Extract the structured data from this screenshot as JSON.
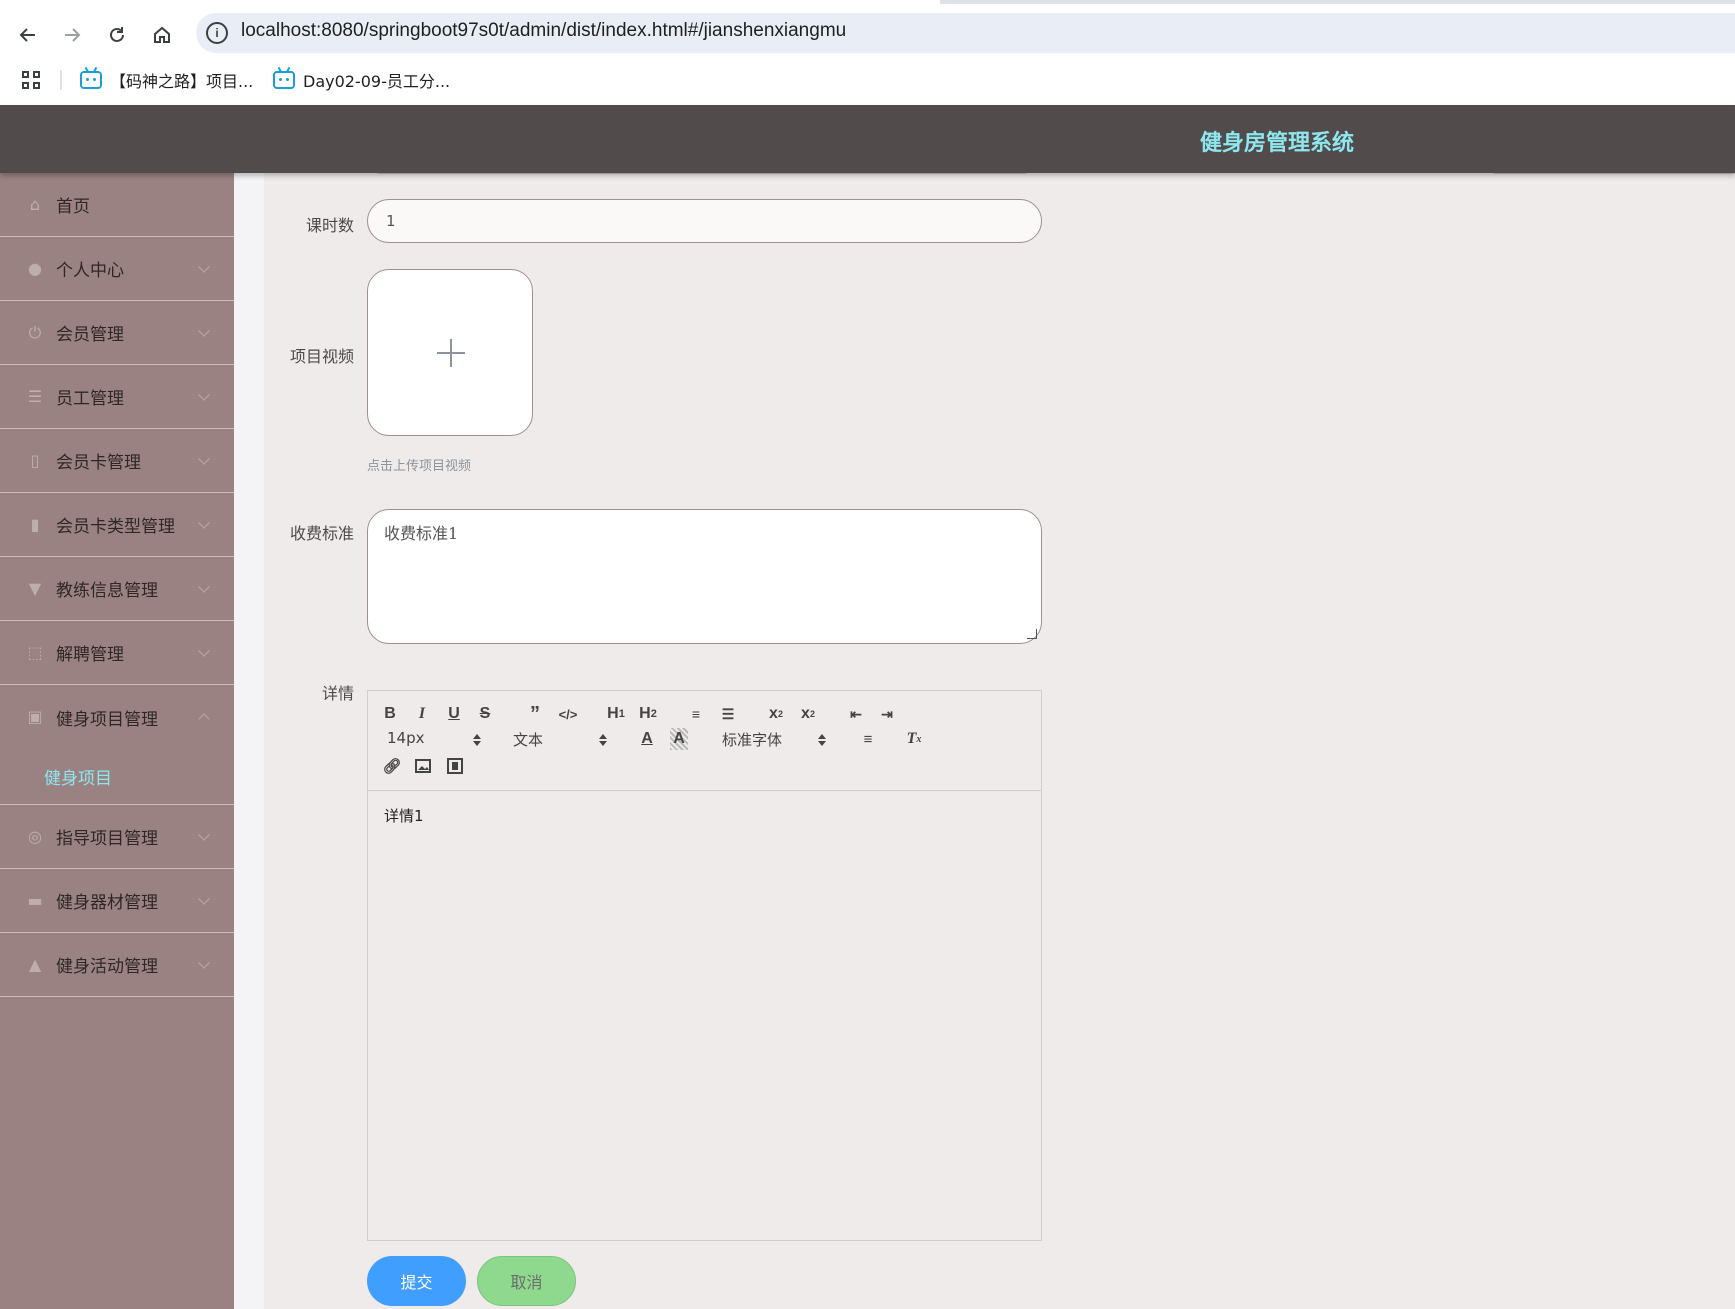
{
  "browser": {
    "url": "localhost:8080/springboot97s0t/admin/dist/index.html#/jianshenxiangmu",
    "bookmarks": [
      {
        "label": "【码神之路】项目..."
      },
      {
        "label": "Day02-09-员工分..."
      }
    ]
  },
  "header": {
    "title": "健身房管理系统"
  },
  "sidebar": {
    "items": [
      {
        "label": "首页",
        "icon": "home-icon"
      },
      {
        "label": "个人中心",
        "icon": "user-icon"
      },
      {
        "label": "会员管理",
        "icon": "power-icon"
      },
      {
        "label": "员工管理",
        "icon": "list-icon"
      },
      {
        "label": "会员卡管理",
        "icon": "phone-icon"
      },
      {
        "label": "会员卡类型管理",
        "icon": "chart-icon"
      },
      {
        "label": "教练信息管理",
        "icon": "pin-icon"
      },
      {
        "label": "解聘管理",
        "icon": "frame-icon"
      },
      {
        "label": "健身项目管理",
        "icon": "clipboard-icon"
      },
      {
        "label": "指导项目管理",
        "icon": "compass-icon"
      },
      {
        "label": "健身器材管理",
        "icon": "ticket-icon"
      },
      {
        "label": "健身活动管理",
        "icon": "thumb-icon"
      }
    ],
    "active_sub": {
      "label": "健身项目"
    }
  },
  "form": {
    "class_hours": {
      "label": "课时数",
      "value": "1"
    },
    "video": {
      "label": "项目视频",
      "tip": "点击上传项目视频"
    },
    "fee": {
      "label": "收费标准",
      "value": "收费标准1"
    },
    "details": {
      "label": "详情",
      "content": "详情1"
    }
  },
  "editor": {
    "size_picker": "14px",
    "header_picker": "文本",
    "font_picker": "标准字体"
  },
  "buttons": {
    "submit": "提交",
    "cancel": "取消"
  },
  "colors": {
    "header_bg": "#514b4b",
    "title": "#8ee6ee",
    "sidebar_bg": "#9a8282",
    "content_bg": "#efebea",
    "submit": "#409eff",
    "cancel": "#8fd98f"
  }
}
